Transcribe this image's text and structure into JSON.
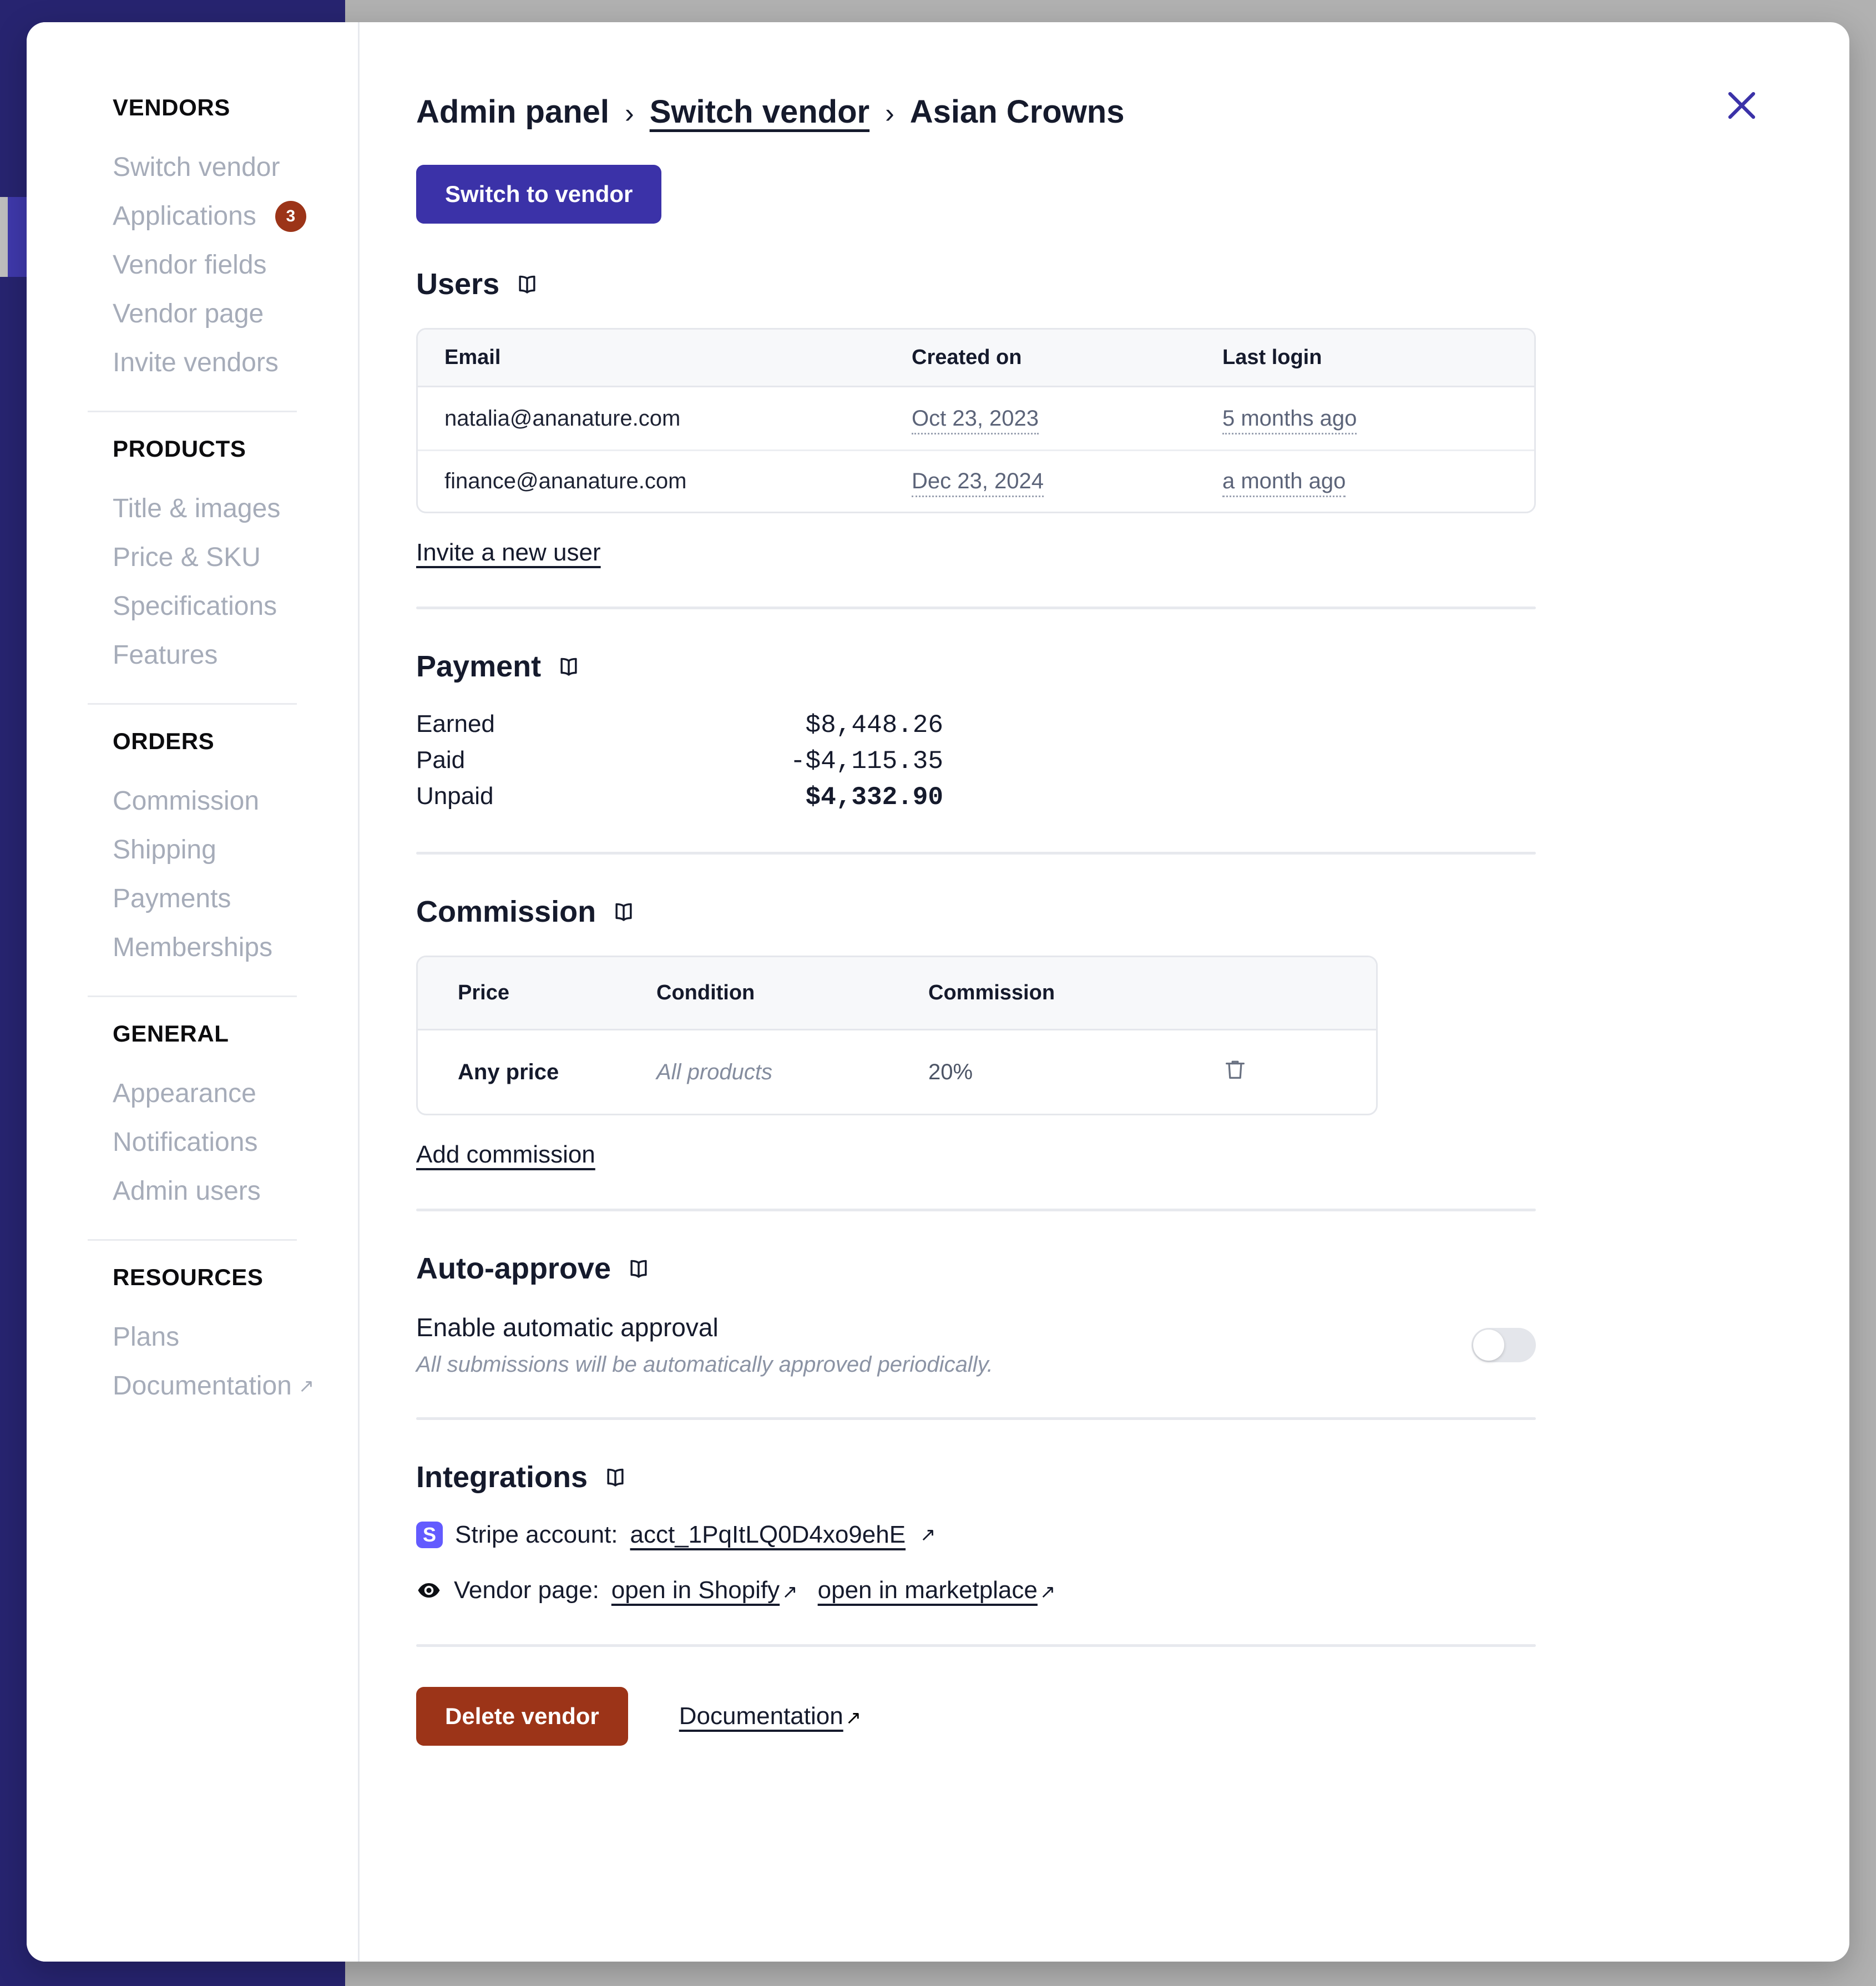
{
  "sidebar": {
    "groups": [
      {
        "title": "VENDORS",
        "items": [
          {
            "label": "Switch vendor",
            "badge": "",
            "external": false
          },
          {
            "label": "Applications",
            "badge": "3",
            "external": false
          },
          {
            "label": "Vendor fields",
            "badge": "",
            "external": false
          },
          {
            "label": "Vendor page",
            "badge": "",
            "external": false
          },
          {
            "label": "Invite vendors",
            "badge": "",
            "external": false
          }
        ]
      },
      {
        "title": "PRODUCTS",
        "items": [
          {
            "label": "Title & images",
            "badge": "",
            "external": false
          },
          {
            "label": "Price & SKU",
            "badge": "",
            "external": false
          },
          {
            "label": "Specifications",
            "badge": "",
            "external": false
          },
          {
            "label": "Features",
            "badge": "",
            "external": false
          }
        ]
      },
      {
        "title": "ORDERS",
        "items": [
          {
            "label": "Commission",
            "badge": "",
            "external": false
          },
          {
            "label": "Shipping",
            "badge": "",
            "external": false
          },
          {
            "label": "Payments",
            "badge": "",
            "external": false
          },
          {
            "label": "Memberships",
            "badge": "",
            "external": false
          }
        ]
      },
      {
        "title": "GENERAL",
        "items": [
          {
            "label": "Appearance",
            "badge": "",
            "external": false
          },
          {
            "label": "Notifications",
            "badge": "",
            "external": false
          },
          {
            "label": "Admin users",
            "badge": "",
            "external": false
          }
        ]
      },
      {
        "title": "RESOURCES",
        "items": [
          {
            "label": "Plans",
            "badge": "",
            "external": false
          },
          {
            "label": "Documentation",
            "badge": "",
            "external": true
          }
        ]
      }
    ]
  },
  "header": {
    "breadcrumb": [
      {
        "label": "Admin panel",
        "is_link": false
      },
      {
        "label": "Switch vendor",
        "is_link": true
      },
      {
        "label": "Asian Crowns",
        "is_link": false
      }
    ],
    "separator": "›",
    "close_icon": "close-icon",
    "switch_button": "Switch to vendor"
  },
  "users": {
    "title": "Users",
    "columns": [
      "Email",
      "Created on",
      "Last login"
    ],
    "rows": [
      {
        "email": "natalia@ananature.com",
        "created_on": "Oct 23, 2023",
        "last_login": "5 months ago"
      },
      {
        "email": "finance@ananature.com",
        "created_on": "Dec 23, 2024",
        "last_login": "a month ago"
      }
    ],
    "invite_link": "Invite a new user"
  },
  "payment": {
    "title": "Payment",
    "rows": [
      {
        "label": "Earned",
        "value": "$8,448.26",
        "bold": false
      },
      {
        "label": "Paid",
        "value": "-$4,115.35",
        "bold": false
      },
      {
        "label": "Unpaid",
        "value": "$4,332.90",
        "bold": true
      }
    ]
  },
  "commission": {
    "title": "Commission",
    "columns": [
      "Price",
      "Condition",
      "Commission"
    ],
    "rows": [
      {
        "price": "Any price",
        "condition": "All products",
        "commission": "20%",
        "delete_icon": "trash-icon"
      }
    ],
    "add_link": "Add commission"
  },
  "auto_approve": {
    "title": "Auto-approve",
    "option_label": "Enable automatic approval",
    "option_description": "All submissions will be automatically approved periodically.",
    "toggle_state": "off"
  },
  "integrations": {
    "title": "Integrations",
    "stripe": {
      "icon": "stripe-icon",
      "label": "Stripe account:",
      "account_id": "acct_1PqItLQ0D4xo9ehE",
      "arrow": "↗"
    },
    "vendor_page": {
      "icon": "eye-icon",
      "label": "Vendor page:",
      "links": [
        {
          "label": "open in Shopify",
          "arrow": "↗"
        },
        {
          "label": "open in marketplace",
          "arrow": "↗"
        }
      ]
    }
  },
  "footer": {
    "delete_button": "Delete vendor",
    "documentation_link": "Documentation",
    "documentation_arrow": "↗"
  },
  "colors": {
    "brand_purple": "#3b32a8",
    "chrome_dark": "#272470",
    "chrome_accent": "#3f39ac",
    "danger": "#9c3418",
    "stripe": "#635bff",
    "backdrop": "#b1b1b1",
    "muted_text": "#a6acb9"
  }
}
